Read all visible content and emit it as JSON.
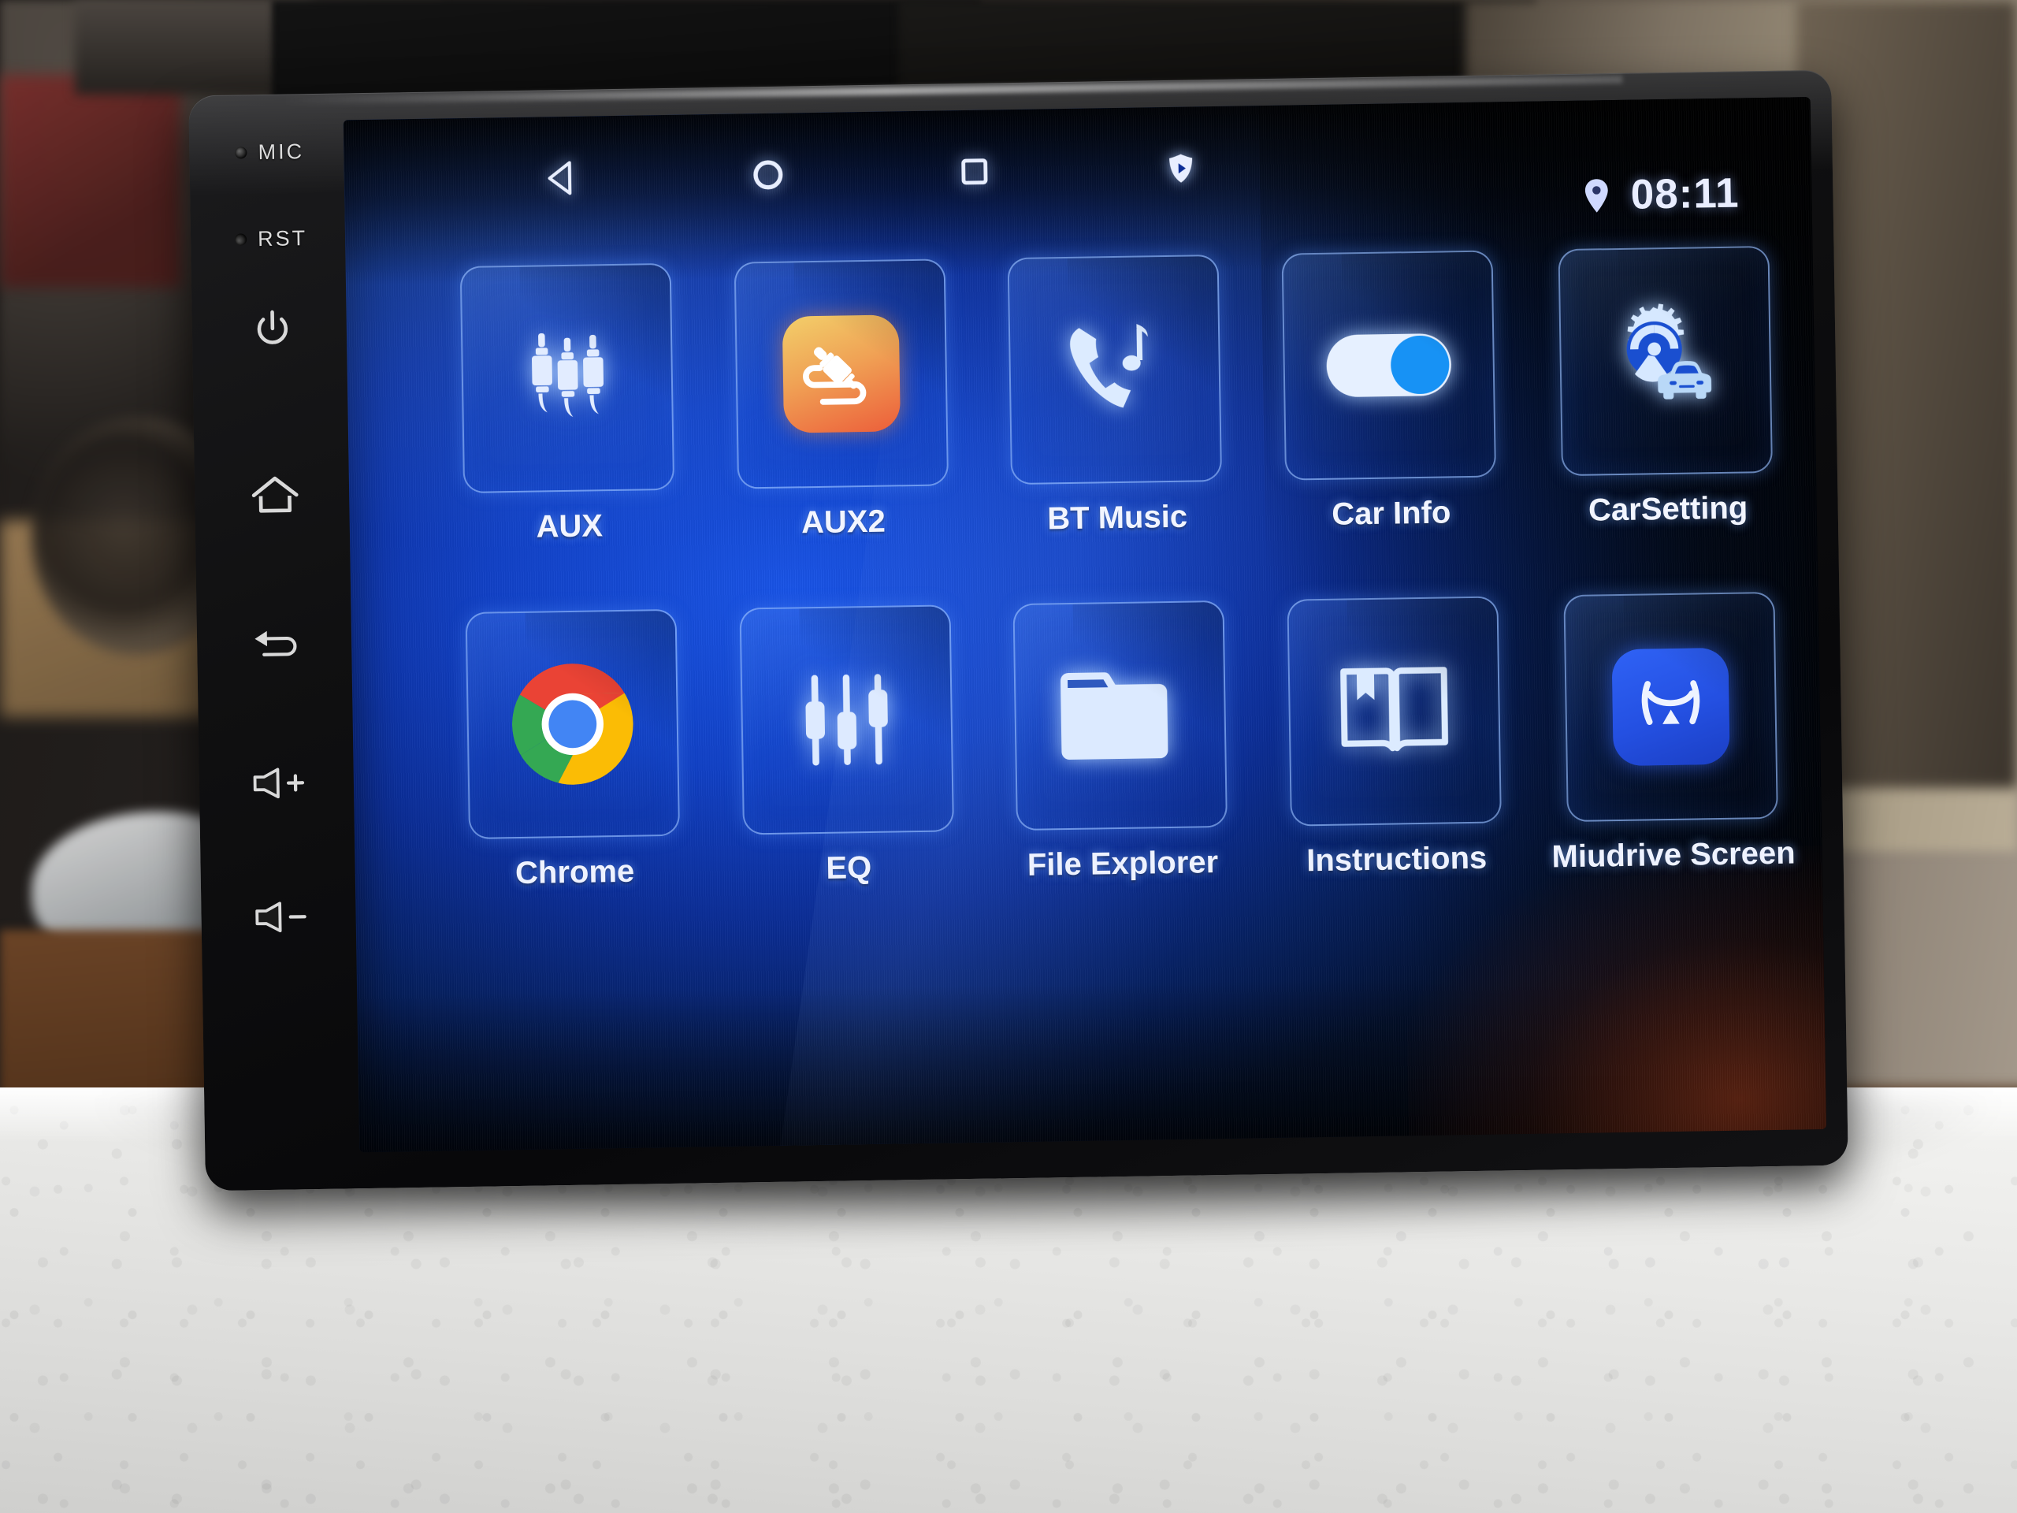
{
  "device": {
    "type": "android-car-head-unit",
    "side_buttons": [
      {
        "id": "mic",
        "label": "MIC",
        "icon": "microphone-hole-icon"
      },
      {
        "id": "rst",
        "label": "RST",
        "icon": "reset-pinhole-icon"
      },
      {
        "id": "power",
        "label": "",
        "icon": "power-icon"
      },
      {
        "id": "home",
        "label": "",
        "icon": "home-icon"
      },
      {
        "id": "back",
        "label": "",
        "icon": "back-arrow-icon"
      },
      {
        "id": "vol-up",
        "label": "+",
        "icon": "volume-up-icon"
      },
      {
        "id": "vol-down",
        "label": "-",
        "icon": "volume-down-icon"
      }
    ]
  },
  "navbar": {
    "items": [
      {
        "name": "back",
        "icon": "triangle-left-icon"
      },
      {
        "name": "home",
        "icon": "circle-icon"
      },
      {
        "name": "recents",
        "icon": "square-icon"
      },
      {
        "name": "volume",
        "icon": "volume-shield-icon"
      }
    ]
  },
  "statusbar": {
    "location_icon": "location-pin-icon",
    "time": "08:11"
  },
  "apps": [
    {
      "label": "AUX",
      "icon": "audio-jack-triple-icon",
      "style": "plain"
    },
    {
      "label": "AUX2",
      "icon": "audio-cable-jack-icon",
      "style": "badge-orange"
    },
    {
      "label": "BT Music",
      "icon": "phone-music-note-icon",
      "style": "plain"
    },
    {
      "label": "Car Info",
      "icon": "toggle-switch-on-icon",
      "style": "plain"
    },
    {
      "label": "CarSetting",
      "icon": "gear-car-icon",
      "style": "plain"
    },
    {
      "label": "Chrome",
      "icon": "chrome-logo-icon",
      "style": "logo"
    },
    {
      "label": "EQ",
      "icon": "equalizer-sliders-icon",
      "style": "plain"
    },
    {
      "label": "File Explorer",
      "icon": "folder-icon",
      "style": "plain"
    },
    {
      "label": "Instructions",
      "icon": "open-book-bookmark-icon",
      "style": "plain"
    },
    {
      "label": "Miudrive Screen",
      "icon": "miudrive-logo-icon",
      "style": "badge-blue"
    }
  ],
  "colors": {
    "screen_blue": "#1141c6",
    "tile_border": "#96beff",
    "icon_white": "#dfeaff",
    "aux2_orange": "#ec5e3a",
    "miudrive_blue": "#2f62f5",
    "chrome_red": "#ea4335",
    "chrome_yellow": "#fbbc05",
    "chrome_green": "#34a853",
    "chrome_blue": "#4285f4"
  }
}
